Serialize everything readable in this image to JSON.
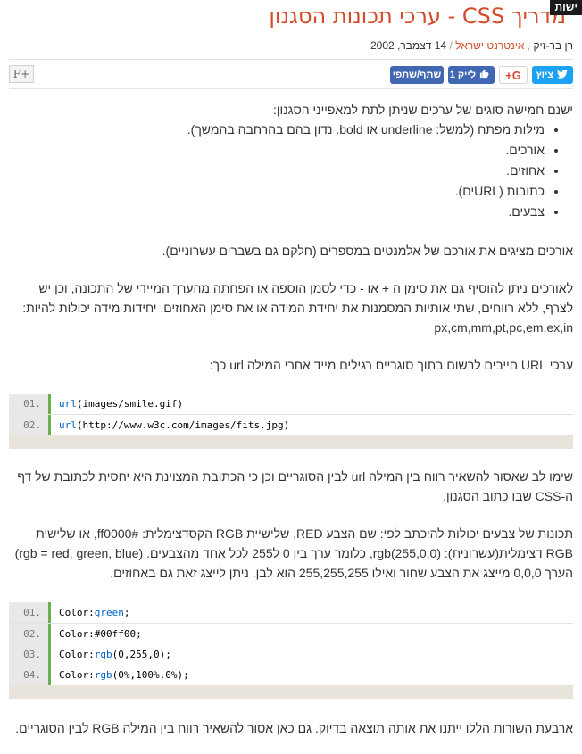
{
  "corner_tag": "ישות",
  "title": "מדריך CSS - ערכי תכונות הסגנון",
  "meta": {
    "author": "רן בר-זיק",
    "site": "אינטרנט ישראל",
    "date": "14 דצמבר, 2002"
  },
  "share": {
    "twitter": "ציוץ",
    "gplus": "G+",
    "like": "לייק 1",
    "share": "שתף/שתפי",
    "font_size": "F+"
  },
  "content": {
    "p1": "ישנם חמישה סוגים של ערכים שניתן לתת למאפייני הסגנון:",
    "list": [
      "מילות מפתח (למשל: underline או bold. נדון בהם בהרחבה בהמשך).",
      "אורכים.",
      "אחוזים.",
      "כתובות (URLים).",
      "צבעים."
    ],
    "p2": "אורכים מציגים את אורכם של אלמנטים במספרים (חלקם גם בשברים עשרוניים).",
    "p3": "לאורכים ניתן להוסיף גם את סימן ה + או - כדי לסמן הוספה או הפחתה מהערך המיידי של התכונה, וכן יש לצרף, ללא רווחים, שתי אותיות המסמנות את יחידת המידה או את סימן האחוזים. יחידות מידה יכולות להיות: px,cm,mm,pt,pc,em,ex,in",
    "p4": "ערכי URL חייבים לרשום בתוך סוגריים רגילים מייד אחרי המילה url כך:",
    "code1": [
      {
        "n": "01.",
        "fn": "url",
        "rest": "(images/smile.gif)"
      },
      {
        "n": "02.",
        "fn": "url",
        "rest": "(http://www.w3c.com/images/fits.jpg)"
      }
    ],
    "p5": "שימו לב שאסור להשאיר רווח בין המילה url לבין הסוגריים וכן כי הכתובת המצוינת היא יחסית לכתובת של דף ה-CSS שבו כתוב הסגנון.",
    "p6": "תכונות של צבעים יכולות להיכתב לפי: שם הצבע RED, שלישיית RGB הקסדצימלית: #ff0000, או שלישית RGB דצימלית(עשרונית): rgb(255,0,0), כלומר ערך בין 0 ל255 לכל אחד מהצבעים. (rgb = red, green, blue) הערך 0,0,0 מייצג את הצבע שחור ואילו 255,255,255 הוא לבן. ניתן לייצג זאת גם באחוזים.",
    "code2": [
      {
        "n": "01.",
        "prop": "Color:",
        "val": "green",
        "end": ";"
      },
      {
        "n": "02.",
        "prop": "Color:",
        "val": "#00ff00",
        "end": ";"
      },
      {
        "n": "03.",
        "prop": "Color:",
        "val": "rgb",
        "end": "(0,255,0);"
      },
      {
        "n": "04.",
        "prop": "Color:",
        "val": "rgb",
        "end": "(0%,100%,0%);"
      }
    ],
    "p7": "ארבעת השורות הללו ייתנו את אותה תוצאה בדיוק. גם כאן אסור להשאיר רווח בין המילה RGB לבין הסוגריים."
  }
}
